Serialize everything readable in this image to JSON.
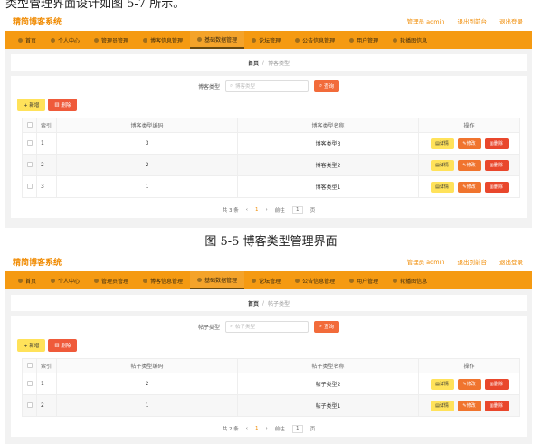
{
  "doc": {
    "top_line": "类型管理界面设计如图 5-7 所示。",
    "caption1": "图 5-5 博客类型管理界面"
  },
  "app": {
    "brand": "精简博客系统",
    "top_links": [
      "管理员 admin",
      "退出到前台",
      "退出登录"
    ],
    "nav": [
      "首页",
      "个人中心",
      "管理员管理",
      "博客信息管理",
      "基础数据管理",
      "论坛管理",
      "公告信息管理",
      "用户管理",
      "轮播图信息"
    ],
    "nav_active_index": 4
  },
  "common": {
    "search_btn": "查询",
    "add_btn": "+ 新增",
    "del_btn": "删除",
    "col_index": "索引",
    "col_ops": "操作",
    "op_detail": "详情",
    "op_edit": "修改",
    "op_del": "删除",
    "page_size_word": "页"
  },
  "screen1": {
    "breadcrumb_home": "首页",
    "breadcrumb_current": "博客类型",
    "search_label": "博客类型",
    "search_placeholder": "博客类型",
    "col_code": "博客类型编码",
    "col_name": "博客类型名称",
    "rows": [
      {
        "idx": "1",
        "code": "3",
        "name": "博客类型3"
      },
      {
        "idx": "2",
        "code": "2",
        "name": "博客类型2"
      },
      {
        "idx": "3",
        "code": "1",
        "name": "博客类型1"
      }
    ],
    "pager_total": "共 3 条",
    "pager_page": "1",
    "pager_goto": "前往",
    "pager_goto_val": "1"
  },
  "screen2": {
    "breadcrumb_home": "首页",
    "breadcrumb_current": "帖子类型",
    "search_label": "帖子类型",
    "search_placeholder": "帖子类型",
    "col_code": "帖子类型编码",
    "col_name": "帖子类型名称",
    "rows": [
      {
        "idx": "1",
        "code": "2",
        "name": "帖子类型2"
      },
      {
        "idx": "2",
        "code": "1",
        "name": "帖子类型1"
      }
    ],
    "pager_total": "共 2 条",
    "pager_page": "1",
    "pager_goto": "前往",
    "pager_goto_val": "1"
  }
}
